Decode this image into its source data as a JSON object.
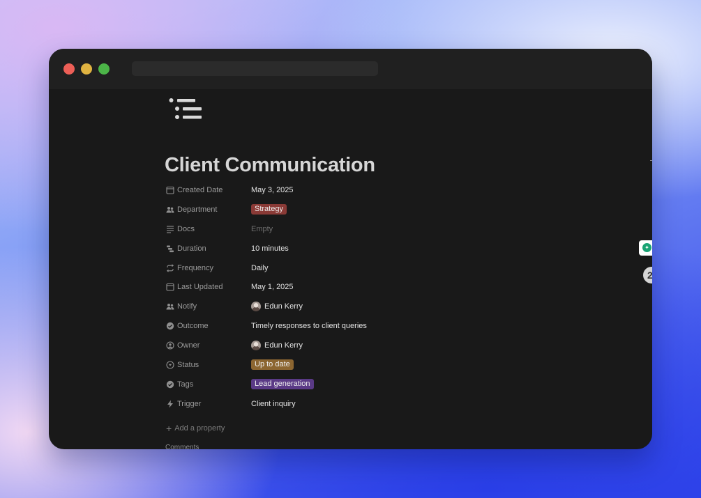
{
  "page": {
    "title": "Client Communication",
    "icon": "bulleted-list-icon"
  },
  "properties": [
    {
      "label": "Created Date",
      "icon": "calendar-icon",
      "value": "May 3, 2025",
      "type": "text"
    },
    {
      "label": "Department",
      "icon": "people-icon",
      "value": "Strategy",
      "type": "tag",
      "color": "#8a3a36"
    },
    {
      "label": "Docs",
      "icon": "text-lines-icon",
      "value": "Empty",
      "type": "empty"
    },
    {
      "label": "Duration",
      "icon": "duration-icon",
      "value": "10 minutes",
      "type": "text"
    },
    {
      "label": "Frequency",
      "icon": "repeat-icon",
      "value": "Daily",
      "type": "text"
    },
    {
      "label": "Last Updated",
      "icon": "calendar-icon",
      "value": "May 1, 2025",
      "type": "text"
    },
    {
      "label": "Notify",
      "icon": "people-icon",
      "value": "Edun Kerry",
      "type": "person"
    },
    {
      "label": "Outcome",
      "icon": "check-circle-icon",
      "value": "Timely responses to client queries",
      "type": "text"
    },
    {
      "label": "Owner",
      "icon": "person-circle-icon",
      "value": "Edun Kerry",
      "type": "person"
    },
    {
      "label": "Status",
      "icon": "status-icon",
      "value": "Up to date",
      "type": "tag",
      "color": "#8c6631"
    },
    {
      "label": "Tags",
      "icon": "check-circle-icon",
      "value": "Lead generation",
      "type": "tag",
      "color": "#5a3a86"
    },
    {
      "label": "Trigger",
      "icon": "lightning-icon",
      "value": "Client inquiry",
      "type": "text"
    }
  ],
  "add_property": "Add a property",
  "comments_label": "Comments",
  "side_badge_number": "2",
  "colors": {
    "window_bg": "#191919",
    "titlebar_bg": "#202020",
    "close": "#ed5f57",
    "minimize": "#e0b341",
    "maximize": "#4cb548"
  }
}
